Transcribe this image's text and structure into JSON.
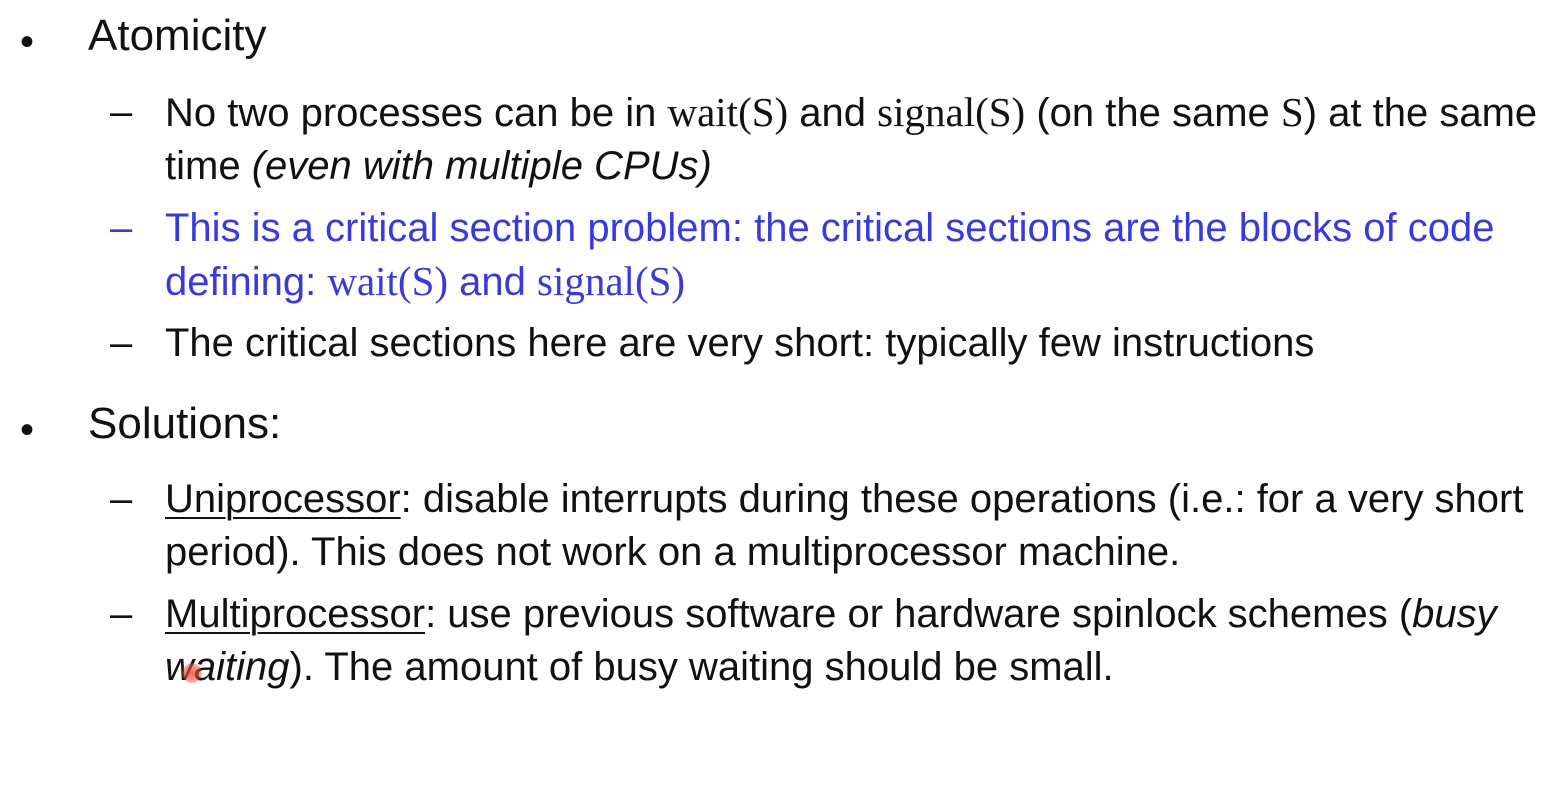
{
  "slide": {
    "bullet_glyph": "•",
    "dash_glyph": "–",
    "atomicity": {
      "heading": "Atomicity",
      "items": [
        {
          "p1": "No two processes can be in ",
          "wait": "wait(S)",
          "p2": " and ",
          "signal": "signal(S)",
          "p3": " (on the same ",
          "s": "S",
          "p4": ") at the same time ",
          "italic": "(even with multiple CPUs)"
        },
        {
          "p1": "This is a critical section problem: the critical sections are the blocks of code defining: ",
          "wait": "wait(S)",
          "p2": " and ",
          "signal": "signal(S)",
          "color": "#3a3adc"
        },
        {
          "text": "The critical sections here are very short: typically few instructions"
        }
      ]
    },
    "solutions": {
      "heading": "Solutions:",
      "items": [
        {
          "term": "Uniprocessor",
          "text": ": disable interrupts during these operations (i.e.: for a very short period). This does not work on a multiprocessor machine."
        },
        {
          "term": "Multiprocessor",
          "p1": ": use previous software or hardware spinlock schemes (",
          "italic": "busy waiting",
          "p2": "). The amount of busy waiting should be small."
        }
      ]
    }
  }
}
